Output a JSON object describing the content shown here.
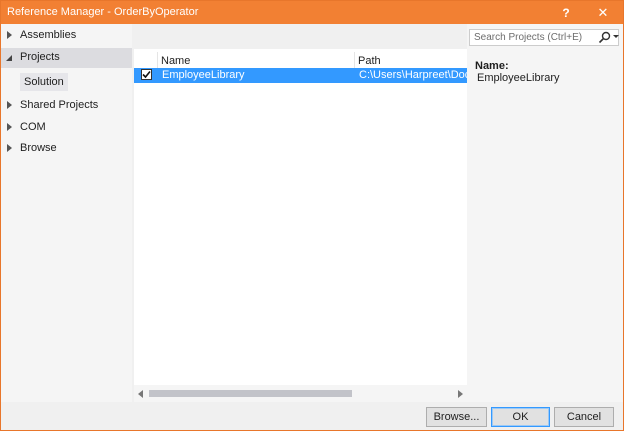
{
  "window": {
    "title": "Reference Manager - OrderByOperator",
    "help_label": "?",
    "close_label": "✕"
  },
  "nav": {
    "items": [
      {
        "label": "Assemblies",
        "state": "collapsed"
      },
      {
        "label": "Projects",
        "state": "expanded"
      },
      {
        "label": "Shared Projects",
        "state": "collapsed"
      },
      {
        "label": "COM",
        "state": "collapsed"
      },
      {
        "label": "Browse",
        "state": "collapsed"
      }
    ],
    "sub_item": "Solution"
  },
  "grid": {
    "columns": [
      "Name",
      "Path"
    ],
    "rows": [
      {
        "checked": true,
        "name": "EmployeeLibrary",
        "path": "C:\\Users\\Harpreet\\Documents"
      }
    ]
  },
  "search": {
    "placeholder": "Search Projects (Ctrl+E)"
  },
  "details": {
    "name_label": "Name:",
    "name_value": "EmployeeLibrary"
  },
  "buttons": {
    "browse": "Browse...",
    "ok": "OK",
    "cancel": "Cancel"
  },
  "colors": {
    "titlebar": "#f28033",
    "selection": "#3399ff"
  }
}
